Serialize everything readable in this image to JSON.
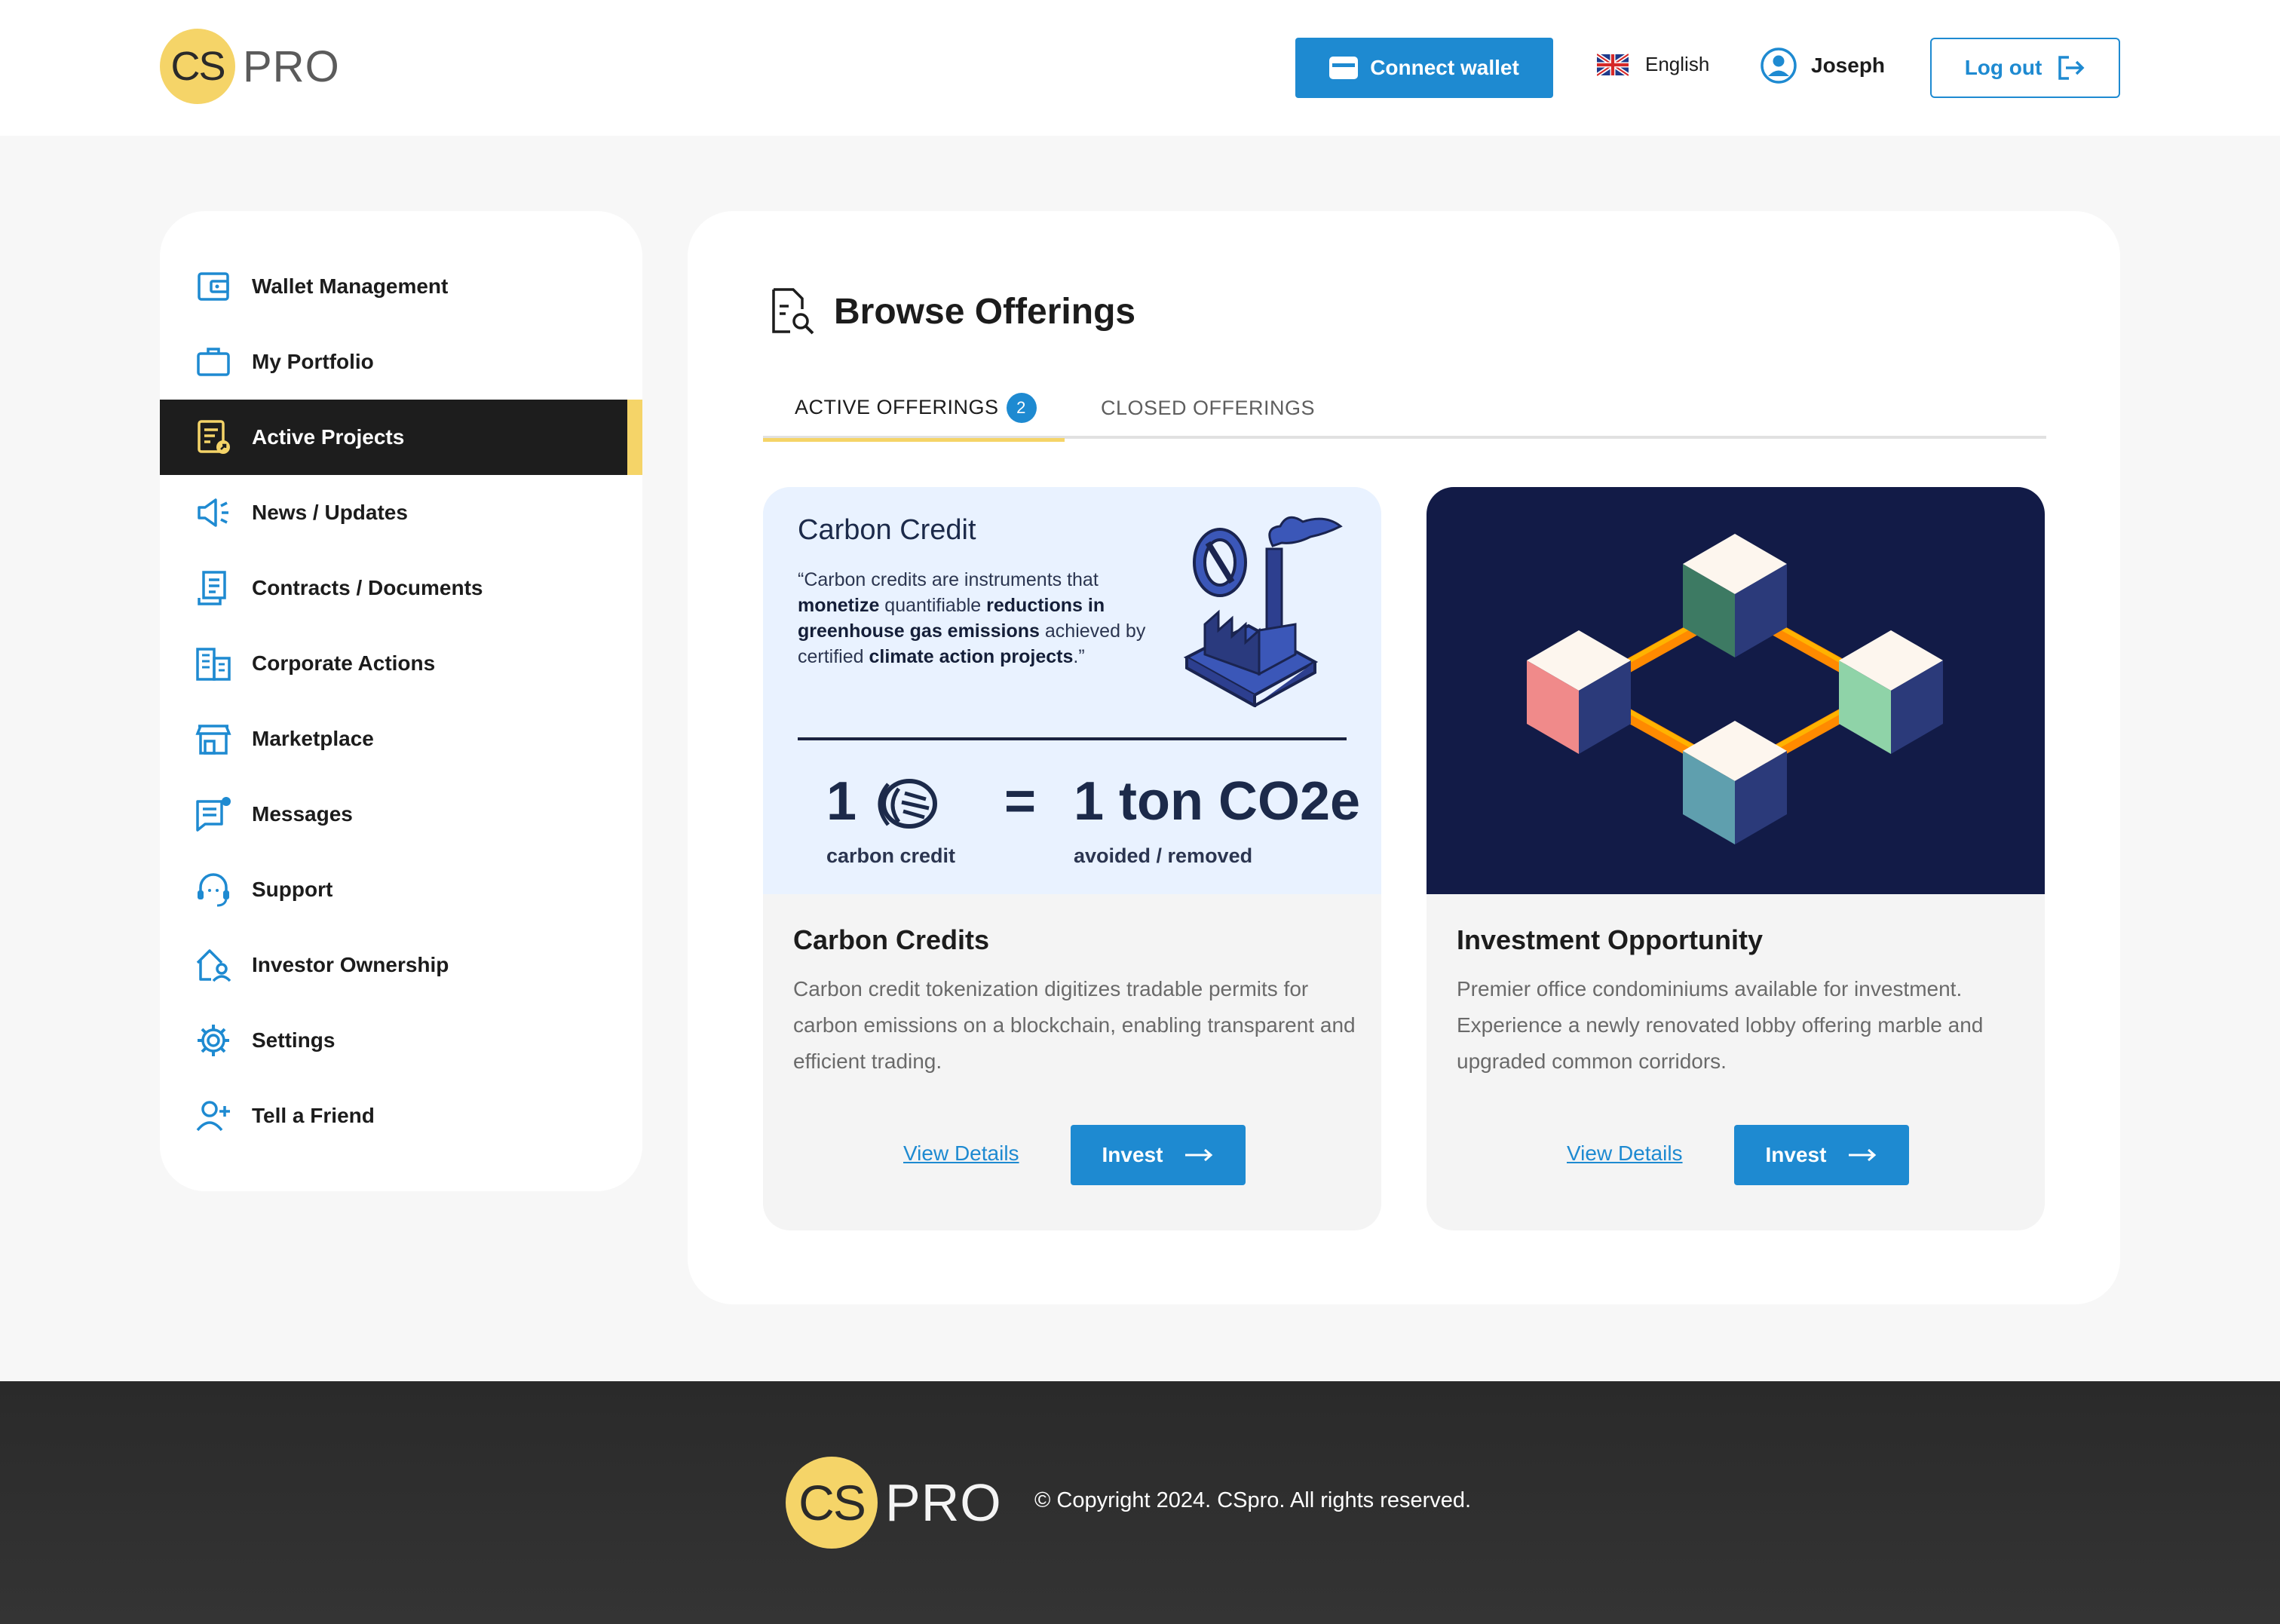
{
  "header": {
    "logo_mark": "CS",
    "logo_text": "PRO",
    "connect_wallet": "Connect wallet",
    "language": "English",
    "username": "Joseph",
    "logout": "Log out"
  },
  "sidebar": {
    "items": [
      {
        "label": "Wallet Management",
        "icon": "wallet-icon"
      },
      {
        "label": "My Portfolio",
        "icon": "briefcase-icon"
      },
      {
        "label": "Active Projects",
        "icon": "projects-icon",
        "active": true
      },
      {
        "label": "News / Updates",
        "icon": "megaphone-icon"
      },
      {
        "label": "Contracts / Documents",
        "icon": "document-icon"
      },
      {
        "label": "Corporate Actions",
        "icon": "building-icon"
      },
      {
        "label": "Marketplace",
        "icon": "store-icon"
      },
      {
        "label": "Messages",
        "icon": "message-icon"
      },
      {
        "label": "Support",
        "icon": "headset-icon"
      },
      {
        "label": "Investor Ownership",
        "icon": "house-user-icon"
      },
      {
        "label": "Settings",
        "icon": "gear-icon"
      },
      {
        "label": "Tell a Friend",
        "icon": "user-plus-icon"
      }
    ]
  },
  "main": {
    "title": "Browse Offerings",
    "tabs": [
      {
        "label": "ACTIVE OFFERINGS",
        "count": "2",
        "active": true
      },
      {
        "label": "CLOSED OFFERINGS"
      }
    ],
    "cards": [
      {
        "image": {
          "heading": "Carbon Credit",
          "quote_parts": [
            "“Carbon credits are instruments that ",
            "monetize",
            " quantifiable ",
            "reductions in greenhouse gas emissions",
            " achieved by certified ",
            "climate action projects",
            ".”"
          ],
          "left_value": "1",
          "left_caption": "carbon credit",
          "equals": "=",
          "right_value": "1 ton CO2e",
          "right_caption": "avoided / removed"
        },
        "title": "Carbon Credits",
        "description": "Carbon credit tokenization digitizes tradable permits for carbon emissions on a blockchain, enabling transparent and efficient trading.",
        "view_details": "View Details",
        "invest": "Invest"
      },
      {
        "title": "Investment Opportunity",
        "description": "Premier office condominiums available for investment. Experience a newly renovated lobby offering marble and upgraded common corridors.",
        "view_details": "View Details",
        "invest": "Invest"
      }
    ]
  },
  "footer": {
    "logo_mark": "CS",
    "logo_text": "PRO",
    "copyright": "© Copyright 2024. CSpro. All rights reserved."
  },
  "colors": {
    "accent_blue": "#1e8ad1",
    "brand_yellow": "#f5d468",
    "active_nav_bg": "#1d1d1d",
    "footer_bg": "#2e2e2e"
  }
}
